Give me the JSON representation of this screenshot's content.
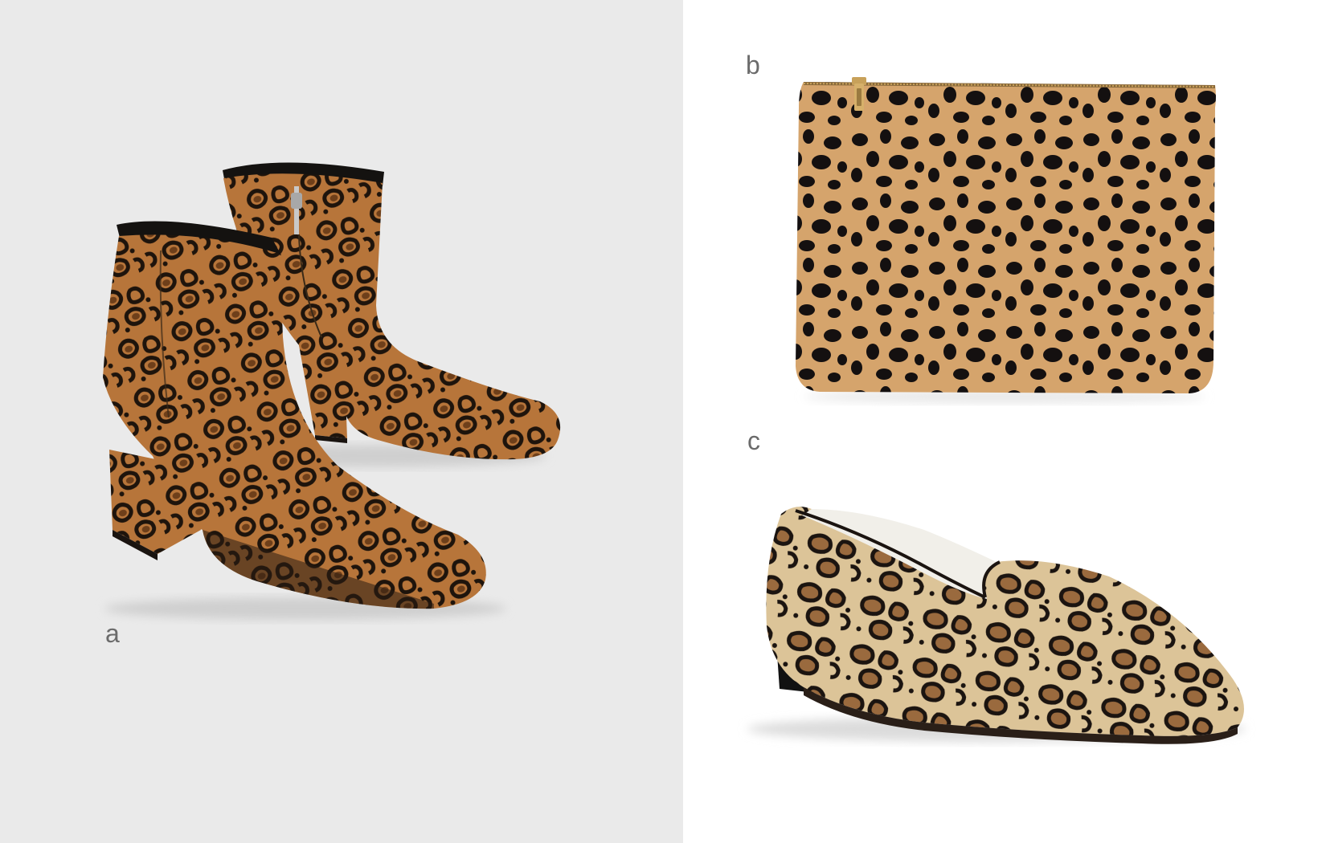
{
  "labels": {
    "a": "a",
    "b": "b",
    "c": "c"
  },
  "colors": {
    "left_background": "#eaeaea",
    "right_background": "#ffffff",
    "label": "#6b6b6b",
    "boot_base": "#b7753a",
    "boot_spot_ring": "#1e140c",
    "boot_spot_center": "#6e3f1a",
    "clutch_base": "#d5a46c",
    "clutch_spot": "#141010",
    "zipper": "#c8a15a",
    "loafer_base": "#dcc498",
    "loafer_spot_ring": "#1b1410",
    "loafer_spot_center": "#9a6a3e",
    "loafer_lining": "#f1efe9"
  },
  "products": [
    {
      "label": "a",
      "kind": "leopard-print-ankle-boots"
    },
    {
      "label": "b",
      "kind": "cheetah-print-zip-clutch"
    },
    {
      "label": "c",
      "kind": "leopard-print-loafer"
    }
  ]
}
